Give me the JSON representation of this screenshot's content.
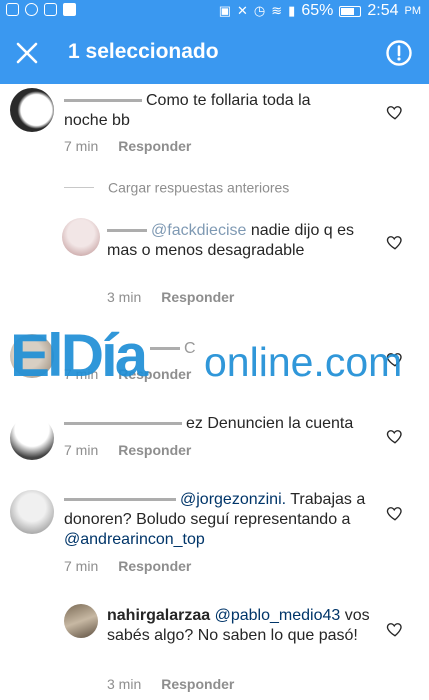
{
  "status_bar": {
    "battery": "65%",
    "time": "2:54",
    "ampm": "PM"
  },
  "app_bar": {
    "title": "1 seleccionado"
  },
  "load_previous": "Cargar respuestas anteriores",
  "reply_label": "Responder",
  "comments": [
    {
      "text": "Como te follaria toda la noche bb",
      "time": "7 min"
    },
    {
      "mention": "@fackdiecise",
      "text": "nadie dijo q es mas o menos desagradable",
      "time": "3 min"
    },
    {
      "text": "C",
      "time": "7 min"
    },
    {
      "text": "ez Denuncien la cuenta",
      "time": "7 min"
    },
    {
      "mention": "@jorgezonzini.",
      "text": "Trabajas a donoren? Boludo seguí representando a",
      "mention2": "@andrearincon_top",
      "time": "7 min"
    },
    {
      "user": "nahirgalarzaa",
      "mention": "@pablo_medio43",
      "text": "vos sabés algo? No saben lo que pasó!",
      "time": "3 min"
    }
  ],
  "watermark": {
    "brand": "ElDía",
    "suffix": "online.com"
  },
  "colors": {
    "accent": "#3a98f0",
    "mention": "#003569",
    "meta": "#8e8e8e",
    "watermark": "#1f8fd6"
  }
}
